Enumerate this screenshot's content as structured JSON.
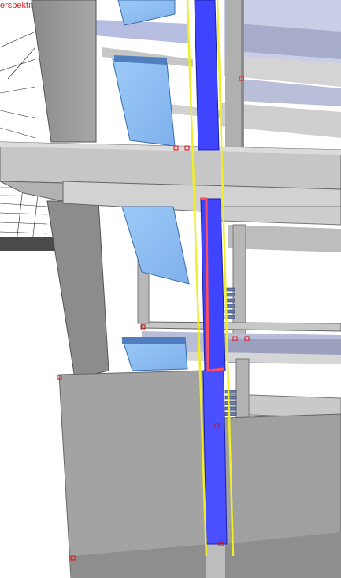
{
  "viewport": {
    "view_label": "erspektif",
    "view_label_color": "#e0201c"
  },
  "scene": {
    "description_tags": [
      "3d-building-model",
      "perspective-view"
    ],
    "colors": {
      "concrete": "#9c9c9c",
      "concrete_light": "#c8c8c8",
      "concrete_dark": "#7e7e7e",
      "glass": "#8fbef2",
      "duct_blue": "#3f45ff",
      "guide_yellow": "#f0ee24",
      "selection_red": "#ff4040",
      "lavender_slab": "#b9bfd9"
    }
  }
}
